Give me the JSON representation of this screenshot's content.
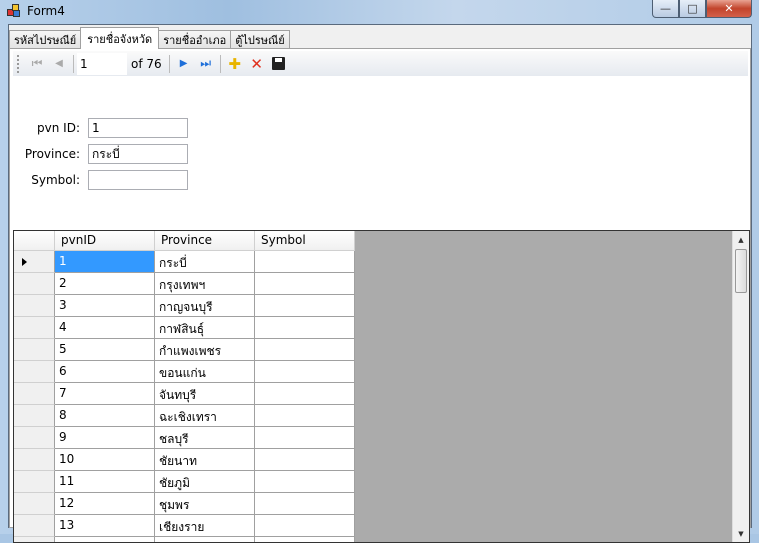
{
  "window": {
    "title": "Form4",
    "minimize": "—",
    "maximize": "□",
    "close": "✕"
  },
  "tabs": [
    {
      "label": "รหัสไปรษณีย์"
    },
    {
      "label": "รายชื่อจังหวัด"
    },
    {
      "label": "รายชื่ออำเภอ"
    },
    {
      "label": "ตู้ไปรษณีย์"
    }
  ],
  "navigator": {
    "position": "1",
    "count_label": "of 76",
    "first": "⏮",
    "prev": "◀",
    "next": "▶",
    "last": "⏭",
    "add": "✚",
    "delete": "✕",
    "save": "💾"
  },
  "form": {
    "pvn_id_label": "pvn ID:",
    "pvn_id_value": "1",
    "province_label": "Province:",
    "province_value": "กระบี่",
    "symbol_label": "Symbol:",
    "symbol_value": ""
  },
  "grid": {
    "columns": [
      "pvnID",
      "Province",
      "Symbol"
    ],
    "rows": [
      {
        "id": "1",
        "province": "กระบี่",
        "symbol": ""
      },
      {
        "id": "2",
        "province": "กรุงเทพฯ",
        "symbol": ""
      },
      {
        "id": "3",
        "province": "กาญจนบุรี",
        "symbol": ""
      },
      {
        "id": "4",
        "province": "กาฬสินธุ์",
        "symbol": ""
      },
      {
        "id": "5",
        "province": "กำแพงเพชร",
        "symbol": ""
      },
      {
        "id": "6",
        "province": "ขอนแก่น",
        "symbol": ""
      },
      {
        "id": "7",
        "province": "จันทบุรี",
        "symbol": ""
      },
      {
        "id": "8",
        "province": "ฉะเชิงเทรา",
        "symbol": ""
      },
      {
        "id": "9",
        "province": "ชลบุรี",
        "symbol": ""
      },
      {
        "id": "10",
        "province": "ชัยนาท",
        "symbol": ""
      },
      {
        "id": "11",
        "province": "ชัยภูมิ",
        "symbol": ""
      },
      {
        "id": "12",
        "province": "ชุมพร",
        "symbol": ""
      },
      {
        "id": "13",
        "province": "เชียงราย",
        "symbol": ""
      },
      {
        "id": "",
        "province": "",
        "symbol": ""
      }
    ]
  }
}
